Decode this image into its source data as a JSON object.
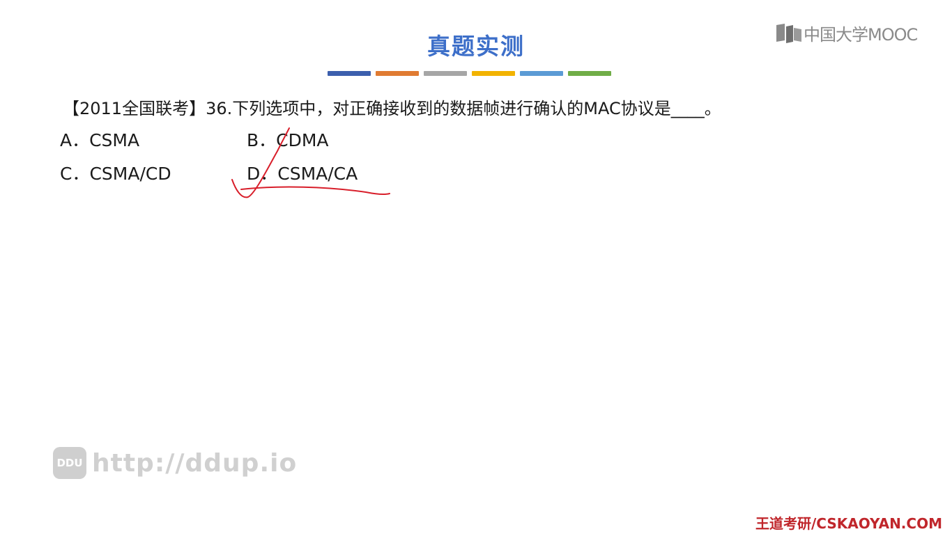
{
  "brand": {
    "logo_text": "中国大学MOOC"
  },
  "slide": {
    "title": "真题实测",
    "color_bars": [
      "#3c5fad",
      "#e07b32",
      "#a6a6a6",
      "#f2b300",
      "#5b9bd5",
      "#70ad47"
    ],
    "question": "【2011全国联考】36.下列选项中，对正确接收到的数据帧进行确认的MAC协议是____。",
    "options": [
      {
        "label": "A．CSMA"
      },
      {
        "label": "B．CDMA"
      },
      {
        "label": "C．CSMA/CD"
      },
      {
        "label": "D．CSMA/CA"
      }
    ],
    "annotation_color": "#d81e2a"
  },
  "watermark": {
    "badge": "DDU",
    "url": "http://ddup.io"
  },
  "footer": {
    "text": "王道考研/CSKAOYAN.COM"
  }
}
